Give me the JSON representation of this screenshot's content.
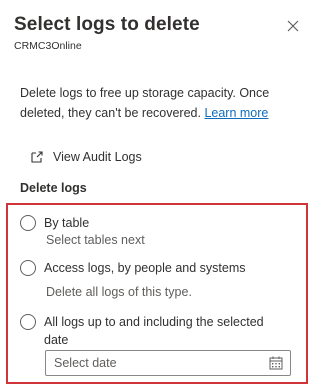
{
  "panel": {
    "title": "Select logs to delete",
    "subtitle": "CRMC3Online",
    "close_icon": "close-icon"
  },
  "description": {
    "text": "Delete logs to free up storage capacity. Once deleted, they can't be recovered. ",
    "link": "Learn more"
  },
  "audit_link": {
    "label": "View Audit Logs",
    "icon": "external-link-icon"
  },
  "section": {
    "label": "Delete logs"
  },
  "options": [
    {
      "label": "By table",
      "sublabel": "Select tables next",
      "selected": false
    },
    {
      "label": "Access logs, by people and systems",
      "sublabel": "Delete all logs of this type.",
      "selected": false
    },
    {
      "label": "All logs up to and including the selected date",
      "sublabel": "",
      "selected": false
    }
  ],
  "date_field": {
    "placeholder": "Select date",
    "icon": "calendar-icon"
  },
  "colors": {
    "highlight_border": "#d13438",
    "link": "#0f6cbd",
    "text": "#323130"
  }
}
